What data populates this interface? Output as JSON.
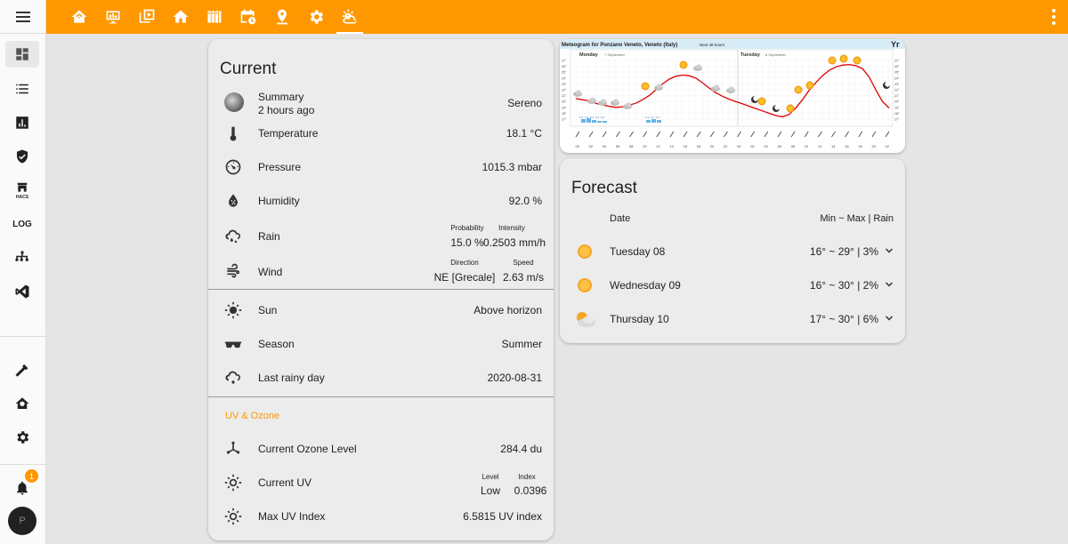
{
  "topbar": {
    "tabs": [
      "home-automation-icon",
      "monitor-dashboard-icon",
      "media-icon",
      "home-icon",
      "server-icon",
      "calendar-clock-icon",
      "map-marker-icon",
      "gear-icon",
      "weather-partly-cloudy-icon"
    ],
    "active_tab": 8,
    "accent_color": "#ff9800"
  },
  "sidebar": {
    "items": [
      "dashboard-icon",
      "logbook-list-icon",
      "history-chart-icon",
      "security-shield-icon",
      "hacs-icon",
      "log-icon",
      "network-icon",
      "vscode-icon",
      "developer-tools-icon",
      "supervisor-icon",
      "settings-icon"
    ],
    "hacs_label": "HACS",
    "log_label": "LOG",
    "notification_count": "1",
    "avatar_initial": "P"
  },
  "current": {
    "title": "Current",
    "summary": {
      "label": "Summary",
      "ago": "2 hours ago",
      "value": "Sereno"
    },
    "temperature": {
      "label": "Temperature",
      "value": "18.1 °C"
    },
    "pressure": {
      "label": "Pressure",
      "value": "1015.3 mbar"
    },
    "humidity": {
      "label": "Humidity",
      "value": "92.0 %"
    },
    "rain": {
      "label": "Rain",
      "prob_head": "Probability",
      "prob_val": "15.0 %",
      "int_head": "Intensity",
      "int_val": "0.2503 mm/h"
    },
    "wind": {
      "label": "Wind",
      "dir_head": "Direction",
      "dir_val": "NE [Grecale]",
      "speed_head": "Speed",
      "speed_val": "2.63 m/s"
    },
    "sun": {
      "label": "Sun",
      "value": "Above horizon"
    },
    "season": {
      "label": "Season",
      "value": "Summer"
    },
    "last_rainy": {
      "label": "Last rainy day",
      "value": "2020-08-31"
    },
    "uv_section": "UV & Ozone",
    "ozone": {
      "label": "Current Ozone Level",
      "value": "284.4 du"
    },
    "uv": {
      "label": "Current UV",
      "level_head": "Level",
      "level_val": "Low",
      "index_head": "Index",
      "index_val": "0.0396"
    },
    "max_uv": {
      "label": "Max UV Index",
      "value": "6.5815 UV index"
    }
  },
  "meteogram": {
    "title": "Meteogram for Ponzano Veneto, Veneto (Italy)",
    "subtitle": "Next 48 hours",
    "logo": "Yr",
    "day1": "Monday",
    "day1_date": "7 September",
    "day2": "Tuesday",
    "day2_date": "8 September",
    "y_ticks": [
      "27°",
      "26°",
      "25°",
      "24°",
      "23°",
      "22°",
      "21°",
      "20°",
      "19°",
      "18°",
      "17°"
    ],
    "x_ticks": [
      "00",
      "02",
      "04",
      "06",
      "08",
      "10",
      "12",
      "14",
      "16",
      "18",
      "20",
      "22",
      "00",
      "02",
      "04",
      "06",
      "08",
      "10",
      "12",
      "14",
      "16",
      "18",
      "20",
      "22"
    ],
    "rain_labels_1": [
      "0.1",
      "0.1",
      "0.2",
      "0.1",
      "0.1"
    ],
    "rain_labels_2": [
      "0.1",
      "0.1",
      "0.1"
    ],
    "line_color": "#e00000",
    "rain_color": "#68b4e6"
  },
  "forecast": {
    "title": "Forecast",
    "date_head": "Date",
    "range_head": "Min ~ Max | Rain",
    "days": [
      {
        "day": "Tuesday 08",
        "range": "16° ~ 29° | 3%",
        "icon": "sunny-icon"
      },
      {
        "day": "Wednesday 09",
        "range": "16° ~ 30° | 2%",
        "icon": "sunny-icon"
      },
      {
        "day": "Thursday 10",
        "range": "17° ~ 30° | 6%",
        "icon": "partly-cloudy-icon"
      }
    ]
  }
}
